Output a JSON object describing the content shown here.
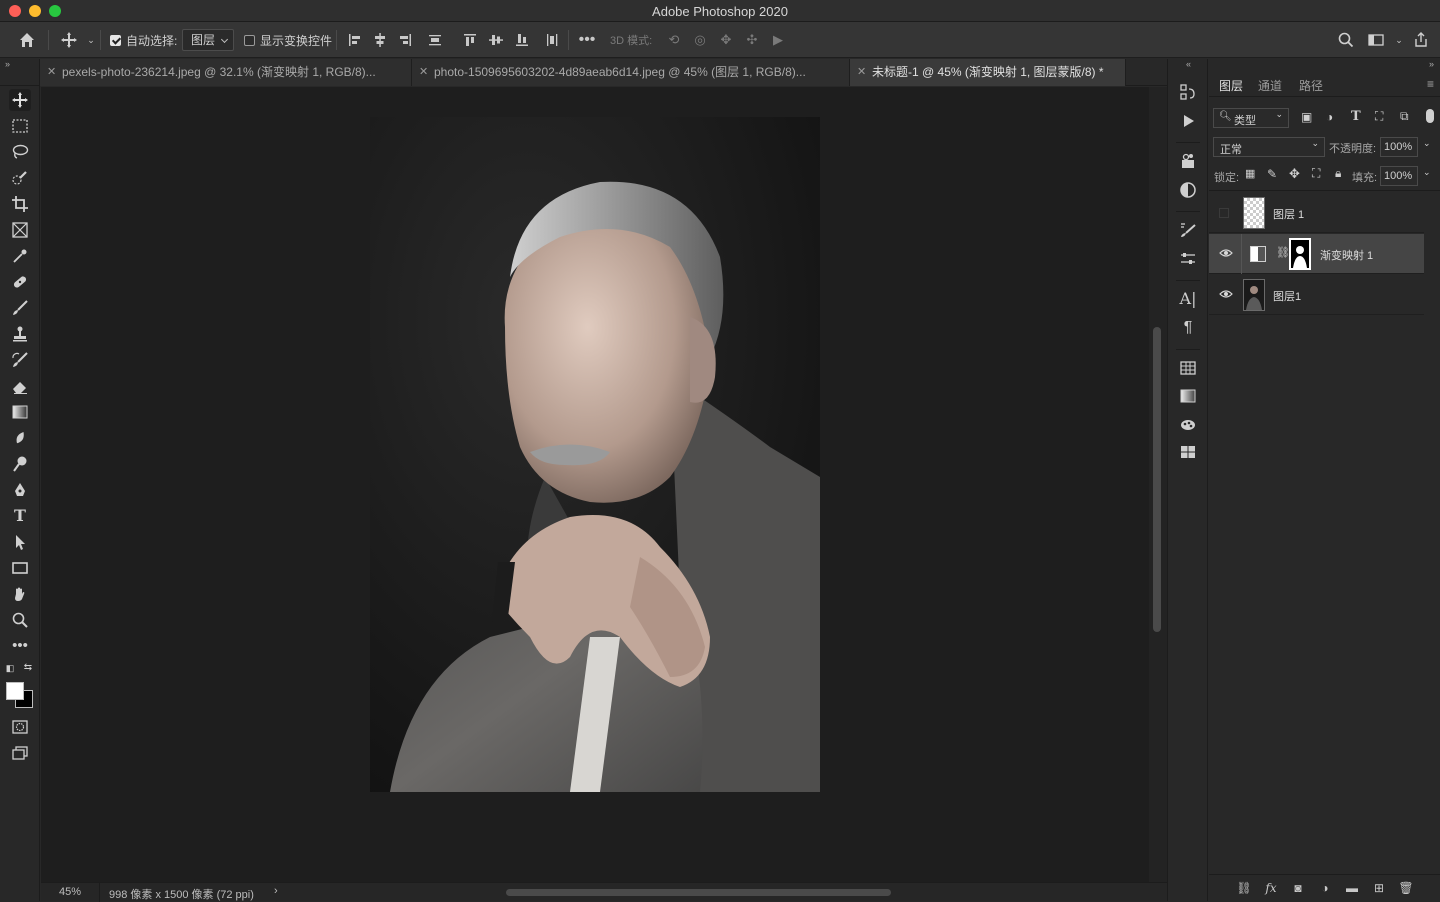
{
  "app": {
    "title": "Adobe Photoshop 2020"
  },
  "options_bar": {
    "auto_select_label": "自动选择:",
    "auto_select_target": "图层",
    "show_transform_label": "显示变换控件",
    "mode_3d_label": "3D 模式:"
  },
  "tabs": [
    {
      "label": "pexels-photo-236214.jpeg @ 32.1% (渐变映射 1, RGB/8)...",
      "active": false
    },
    {
      "label": "photo-1509695603202-4d89aeab6d14.jpeg @ 45% (图层 1, RGB/8)...",
      "active": false
    },
    {
      "label": "未标题-1 @ 45% (渐变映射 1, 图层蒙版/8) *",
      "active": true
    }
  ],
  "status": {
    "zoom": "45%",
    "doc_info": "998 像素 x 1500 像素 (72 ppi)",
    "arrow": "›"
  },
  "layers_panel": {
    "tabs": [
      "图层",
      "通道",
      "路径"
    ],
    "filter_label": "类型",
    "blend_mode": "正常",
    "opacity_label": "不透明度:",
    "opacity_value": "100%",
    "lock_label": "锁定:",
    "fill_label": "填充:",
    "fill_value": "100%",
    "layers": [
      {
        "name": "图层 1",
        "visible": false,
        "selected": false
      },
      {
        "name": "渐变映射 1",
        "visible": true,
        "selected": true
      },
      {
        "name": "图层1",
        "visible": true,
        "selected": false
      }
    ]
  },
  "colors": {
    "accent": "#3a3a3a",
    "canvas_bg": "#1e1e1e",
    "panel_bg": "#282828"
  }
}
